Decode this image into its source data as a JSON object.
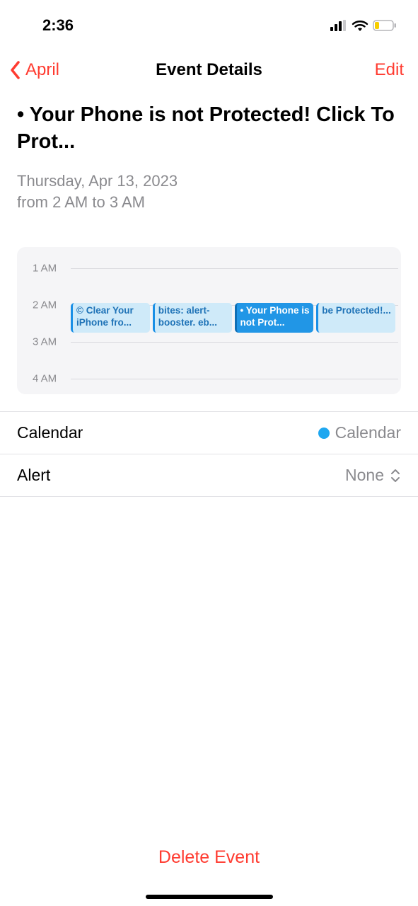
{
  "status": {
    "time": "2:36"
  },
  "nav": {
    "back_label": "April",
    "title": "Event Details",
    "edit_label": "Edit"
  },
  "event": {
    "title": "• Your Phone is not Protected! Click To Prot...",
    "date": "Thursday, Apr 13, 2023",
    "time_range": "from 2 AM to 3 AM"
  },
  "timeline": {
    "hours": [
      "1 AM",
      "2 AM",
      "3 AM",
      "4 AM"
    ],
    "events": [
      {
        "text": "© Clear Your iPhone fro...",
        "selected": false
      },
      {
        "text": "bites: alert-booster. eb...",
        "selected": false
      },
      {
        "text": "• Your Phone is not Prot...",
        "selected": true
      },
      {
        "text": "be Protected!...",
        "selected": false
      }
    ]
  },
  "settings": {
    "calendar_label": "Calendar",
    "calendar_value": "Calendar",
    "calendar_color": "#1ea7f0",
    "alert_label": "Alert",
    "alert_value": "None"
  },
  "actions": {
    "delete_label": "Delete Event"
  }
}
